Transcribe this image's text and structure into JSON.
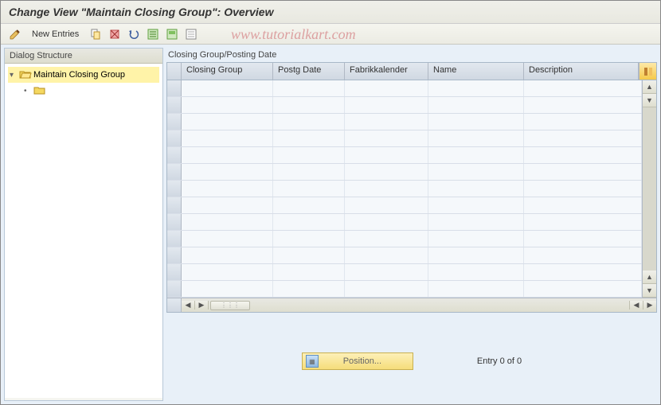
{
  "title": "Change View \"Maintain Closing Group\": Overview",
  "watermark": "www.tutorialkart.com",
  "toolbar": {
    "new_entries": "New Entries"
  },
  "left_panel": {
    "header": "Dialog Structure",
    "tree": {
      "root": "Maintain Closing Group",
      "child": ""
    }
  },
  "grid": {
    "title": "Closing Group/Posting Date",
    "columns": [
      "Closing Group",
      "Postg Date",
      "Fabrikkalender",
      "Name",
      "Description"
    ],
    "row_count": 13
  },
  "bottom": {
    "position_label": "Position...",
    "entry_text": "Entry 0 of 0"
  }
}
